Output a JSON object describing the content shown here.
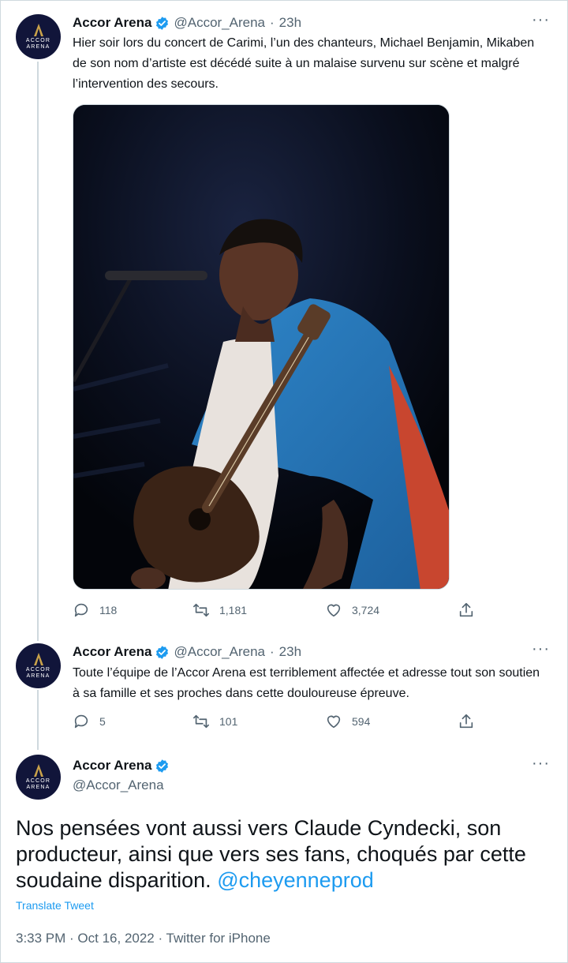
{
  "account": {
    "name": "Accor Arena",
    "handle": "@Accor_Arena",
    "avatar_text": [
      "ACCOR",
      "ARENA"
    ]
  },
  "tweets": [
    {
      "time": "23h",
      "text": "Hier soir lors du concert de Carimi, l’un des chanteurs, Michael Benjamin, Mikaben de son nom d’artiste est décédé suite à un malaise survenu sur scène et malgré l’intervention des secours.",
      "media": "photo-singer-with-guitar",
      "replies": "118",
      "retweets": "1,181",
      "likes": "3,724"
    },
    {
      "time": "23h",
      "text": "Toute l’équipe de l’Accor Arena est terriblement affectée et adresse tout son soutien à sa famille et ses proches dans cette douloureuse épreuve.",
      "replies": "5",
      "retweets": "101",
      "likes": "594"
    }
  ],
  "main_tweet": {
    "text": "Nos pensées vont aussi vers Claude Cyndecki, son producteur, ainsi que vers ses fans, choqués par cette soudaine disparition.",
    "mention": "@cheyenneprod",
    "translate_label": "Translate Tweet",
    "timestamp": "3:33 PM · Oct 16, 2022 · Twitter for iPhone"
  },
  "icons": {
    "more": "more-icon",
    "verified": "verified-icon",
    "reply": "reply-icon",
    "retweet": "retweet-icon",
    "like": "like-icon",
    "share": "share-icon"
  },
  "colors": {
    "accent": "#1d9bf0",
    "secondary_text": "#536471",
    "avatar_bg": "#11153a",
    "gold": "#c9a24a"
  }
}
